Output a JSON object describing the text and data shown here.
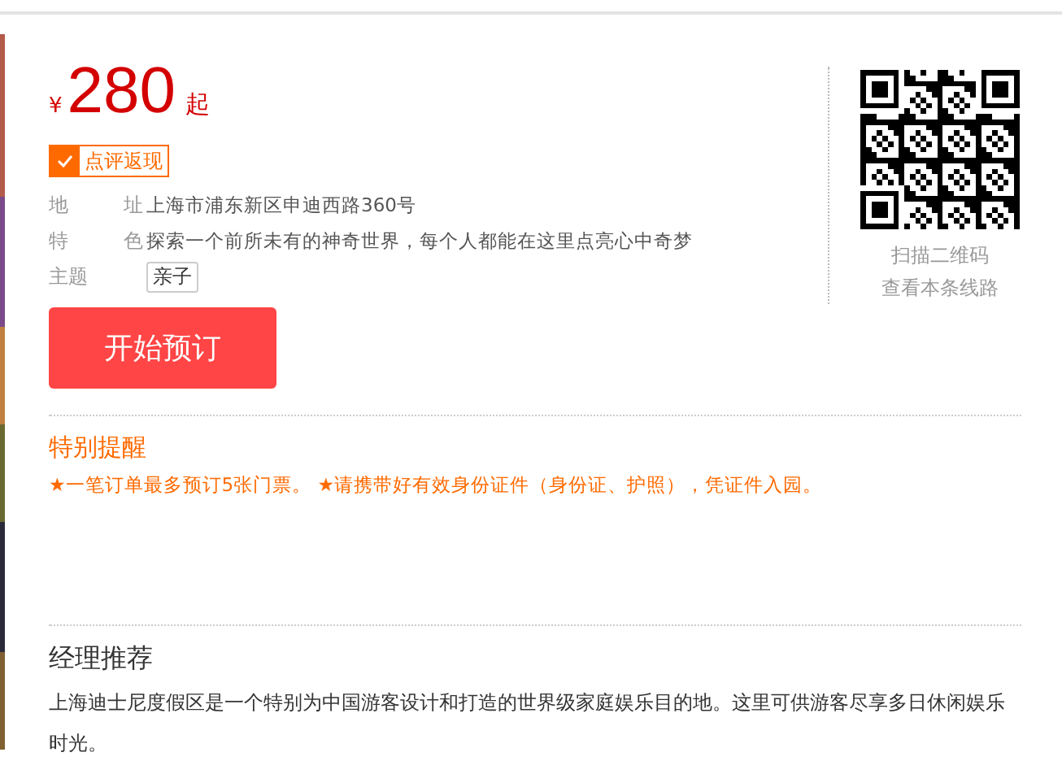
{
  "price": {
    "currency": "¥",
    "amount": "280",
    "suffix": "起"
  },
  "badge": {
    "label": "点评返现",
    "checked": true
  },
  "info": [
    {
      "label": "地",
      "label_end": "址",
      "value": "上海市浦东新区申迪西路360号",
      "kind": "text"
    },
    {
      "label": "特",
      "label_end": "色",
      "value": "探索一个前所未有的神奇世界，每个人都能在这里点亮心中奇梦",
      "kind": "text"
    },
    {
      "label": "主题",
      "value": "亲子",
      "kind": "tag"
    }
  ],
  "book_button": "开始预订",
  "qr": {
    "lines": [
      "扫描二维码",
      "查看本条线路"
    ]
  },
  "notice": {
    "title": "特别提醒",
    "text": "★一笔订单最多预订5张门票。 ★请携带好有效身份证件（身份证、护照），凭证件入园。"
  },
  "recommend": {
    "title": "经理推荐",
    "text": "上海迪士尼度假区是一个特别为中国游客设计和打造的世界级家庭娱乐目的地。这里可供游客尽享多日休闲娱乐时光。"
  }
}
